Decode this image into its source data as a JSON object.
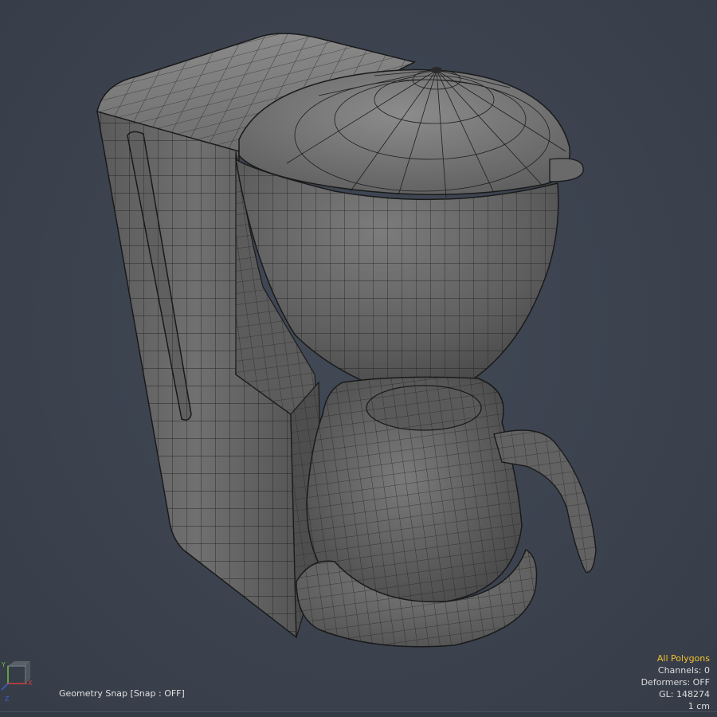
{
  "viewport": {
    "background": "#3c4350",
    "model_name": "coffee-maker",
    "render_style": "shaded-wireframe",
    "mesh_fill": "#6a6a6a",
    "wire_color": "#1c1c1c"
  },
  "status": {
    "snap_label": "Geometry Snap",
    "snap_state": "[Snap : OFF]"
  },
  "stats": {
    "selection_mode": "All Polygons",
    "channels": "Channels: 0",
    "deformers": "Deformers: OFF",
    "gl": "GL: 148274",
    "units": "1 cm",
    "mode_color": "#f0c030"
  },
  "axis_gizmo": {
    "y_label": "Y",
    "x_label": "X",
    "z_label": "Z",
    "y_color": "#70c040",
    "x_color": "#d04040",
    "z_color": "#4060d0"
  }
}
